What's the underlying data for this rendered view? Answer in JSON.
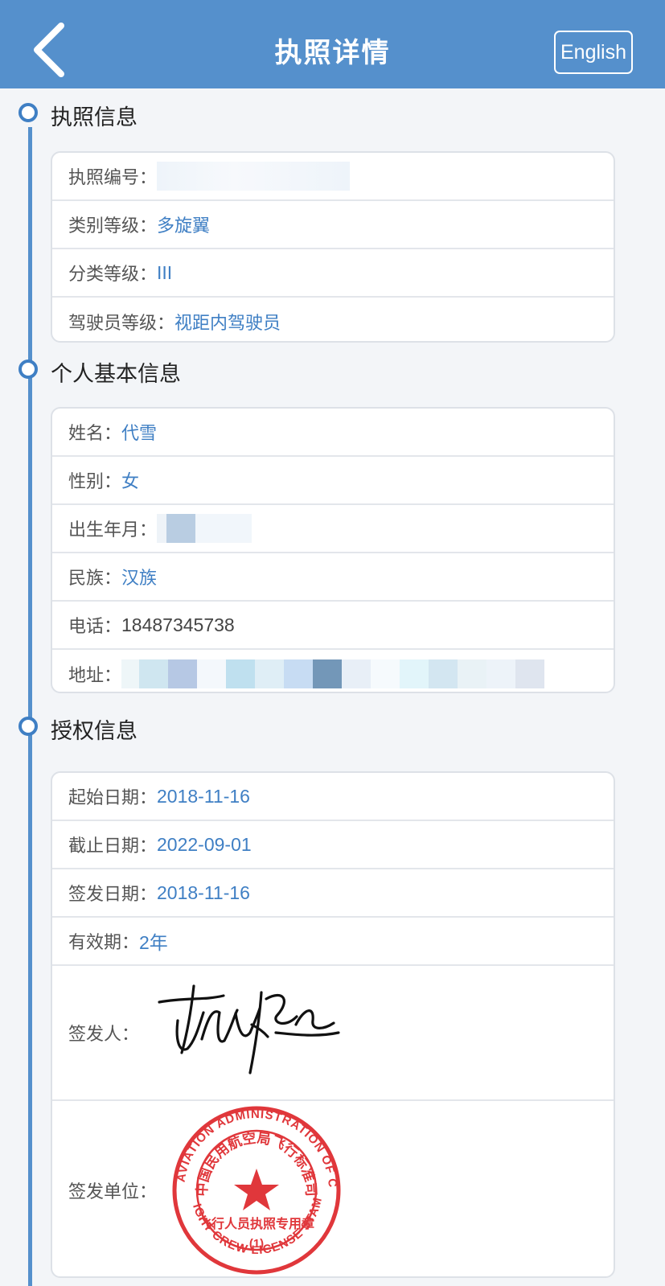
{
  "navbar": {
    "title": "执照详情",
    "lang_button": "English",
    "back_icon": "chevron-left-icon"
  },
  "sections": {
    "license": {
      "title": "执照信息",
      "rows": [
        {
          "label": "执照编号：",
          "value": "",
          "redacted": true
        },
        {
          "label": "类别等级：",
          "value": "多旋翼"
        },
        {
          "label": "分类等级：",
          "value": "III"
        },
        {
          "label": "驾驶员等级：",
          "value": "视距内驾驶员"
        }
      ]
    },
    "personal": {
      "title": "个人基本信息",
      "rows": [
        {
          "label": "姓名：",
          "value": "代雪"
        },
        {
          "label": "性别：",
          "value": "女"
        },
        {
          "label": "出生年月：",
          "value": "",
          "redacted": true
        },
        {
          "label": "民族：",
          "value": "汉族"
        },
        {
          "label": "电话：",
          "value": "18487345738"
        },
        {
          "label": "地址：",
          "value": "",
          "redacted": true
        }
      ]
    },
    "authorization": {
      "title": "授权信息",
      "rows": [
        {
          "label": "起始日期：",
          "value": "2018-11-16"
        },
        {
          "label": "截止日期：",
          "value": "2022-09-01"
        },
        {
          "label": "签发日期：",
          "value": "2018-11-16"
        },
        {
          "label": "有效期：",
          "value": "2年"
        },
        {
          "label": "签发人：",
          "value": "",
          "signature": true
        },
        {
          "label": "签发单位：",
          "value": "",
          "stamp": true
        }
      ]
    }
  },
  "stamp": {
    "outer_text": "CIVIL AVIATION ADMINISTRATION OF CHINA",
    "inner_text": "中国民用航空局飞行标准司",
    "bottom_text": "FLIGHT CREW LICENSE STAMP",
    "center_text": "飞行人员执照专用章",
    "number": "(1)"
  },
  "colors": {
    "navbar": "#5590cc",
    "accent": "#3f7fc4",
    "stamp": "#e0373b"
  }
}
